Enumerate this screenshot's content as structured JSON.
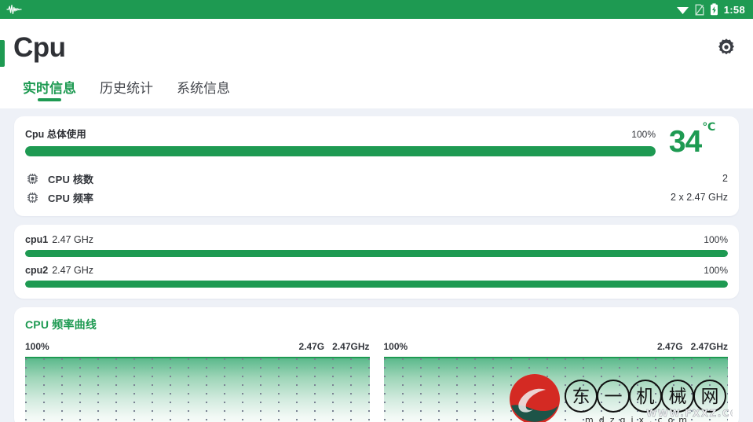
{
  "status_bar": {
    "left_icons": [
      {
        "name": "pulse-waveform-icon"
      }
    ],
    "right_icons": [
      {
        "name": "wifi-icon"
      },
      {
        "name": "sim-card-off-icon"
      },
      {
        "name": "battery-charging-icon"
      }
    ],
    "time": "1:58",
    "background_color": "#1e9a52"
  },
  "app_bar": {
    "title": "Cpu",
    "accent_color": "#1e9a52",
    "settings_icon": "gear-icon"
  },
  "tabs": [
    {
      "label": "实时信息",
      "active": true
    },
    {
      "label": "历史统计",
      "active": false
    },
    {
      "label": "系统信息",
      "active": false
    }
  ],
  "overall": {
    "label": "Cpu 总体使用",
    "percent_text": "100%",
    "percent_value": 100,
    "temperature": "34",
    "temperature_unit": "℃",
    "bar_color": "#1e9a52"
  },
  "info_rows": [
    {
      "icon": "cpu-chip-icon",
      "label": "CPU 核数",
      "value": "2"
    },
    {
      "icon": "cpu-frequency-icon",
      "label": "CPU 频率",
      "value": "2 x 2.47 GHz"
    }
  ],
  "cores": [
    {
      "name": "cpu1",
      "frequency": "2.47 GHz",
      "percent_text": "100%",
      "percent_value": 100
    },
    {
      "name": "cpu2",
      "frequency": "2.47 GHz",
      "percent_text": "100%",
      "percent_value": 100
    }
  ],
  "charts_card": {
    "title": "CPU 频率曲线",
    "charts": [
      {
        "left_label": "100%",
        "right_label_1": "2.47G",
        "right_label_2": "2.47GHz"
      },
      {
        "left_label": "100%",
        "right_label_1": "2.47G",
        "right_label_2": "2.47GHz"
      }
    ]
  },
  "chart_data": {
    "type": "area",
    "title": "CPU 频率曲线",
    "series": [
      {
        "name": "cpu1",
        "unit": "GHz",
        "current": 2.47,
        "max": 2.47,
        "utilization_percent": 100,
        "x": [
          0,
          1,
          2,
          3,
          4,
          5,
          6,
          7,
          8,
          9,
          10,
          11,
          12,
          13,
          14,
          15,
          16,
          17,
          18,
          19
        ],
        "values": [
          2.47,
          2.47,
          2.47,
          2.47,
          2.47,
          2.47,
          2.47,
          2.47,
          2.47,
          2.47,
          2.47,
          2.47,
          2.47,
          2.47,
          2.47,
          2.47,
          2.47,
          2.47,
          2.47,
          2.47
        ]
      },
      {
        "name": "cpu2",
        "unit": "GHz",
        "current": 2.47,
        "max": 2.47,
        "utilization_percent": 100,
        "x": [
          0,
          1,
          2,
          3,
          4,
          5,
          6,
          7,
          8,
          9,
          10,
          11,
          12,
          13,
          14,
          15,
          16,
          17,
          18,
          19
        ],
        "values": [
          2.47,
          2.47,
          2.47,
          2.47,
          2.47,
          2.47,
          2.47,
          2.47,
          2.47,
          2.47,
          2.47,
          2.47,
          2.47,
          2.47,
          2.47,
          2.47,
          2.47,
          2.47,
          2.47,
          2.47
        ]
      }
    ],
    "ylim": [
      0,
      2.47
    ],
    "ylabel": "GHz",
    "xlabel": "",
    "grid": true,
    "legend": "none",
    "line_color": "#1e9a52"
  },
  "watermark": {
    "logo_chars": [
      "东",
      "一",
      "机",
      "械",
      "网"
    ],
    "subtext": "mdzgjx.com",
    "overlay_text": "WWW.FXXZ.COM"
  }
}
